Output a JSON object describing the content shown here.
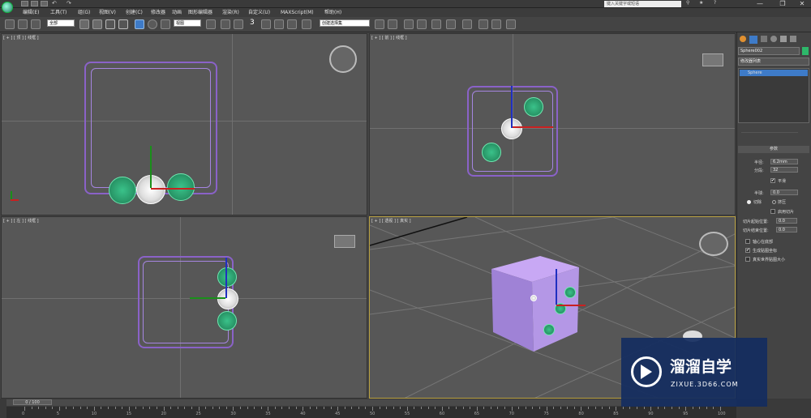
{
  "window": {
    "search_placeholder": "键入关键字或短语",
    "controls": [
      "—",
      "❐",
      "✕"
    ],
    "quick_icons": [
      "▭",
      "▭",
      "▭",
      "↶",
      "↷",
      "▭"
    ]
  },
  "menu": [
    "编辑(E)",
    "工具(T)",
    "组(G)",
    "视图(V)",
    "创建(C)",
    "修改器",
    "动画",
    "图形编辑器",
    "渲染(R)",
    "自定义(U)",
    "MAXScript(M)",
    "帮助(H)"
  ],
  "toolbar": {
    "selection_filter": "全部",
    "ref_coord": "视图",
    "named_selection": "创建选择集",
    "snap_label": "3"
  },
  "viewports": {
    "top": "[ + ] [ 顶 ] [ 线框 ]",
    "front": "[ + ] [ 前 ] [ 线框 ]",
    "left": "[ + ] [ 左 ] [ 线框 ]",
    "persp": "[ + ] [ 透视 ] [ 真实 ]"
  },
  "panel": {
    "object_name": "Sphere002",
    "modifier_list": "修改器列表",
    "stack_item": "Sphere",
    "rollout_title": "参数",
    "radius_label": "半径:",
    "radius_value": "6.2mm",
    "segments_label": "分段:",
    "segments_value": "32",
    "smooth_label": "平滑",
    "hemisphere_label": "半球:",
    "hemisphere_value": "0.0",
    "chop_label": "切除",
    "squash_label": "挤压",
    "slice_on_label": "启用切片",
    "slice_from_label": "切片起始位置:",
    "slice_from_value": "0.0",
    "slice_to_label": "切片结束位置:",
    "slice_to_value": "0.0",
    "base_pivot_label": "轴心在底部",
    "gen_uv_label": "生成贴图坐标",
    "real_world_label": "真实世界贴图大小"
  },
  "timeline": {
    "frame_display": "0 / 100",
    "ticks": [
      "0",
      "5",
      "10",
      "15",
      "20",
      "25",
      "30",
      "35",
      "40",
      "45",
      "50",
      "55",
      "60",
      "65",
      "70",
      "75",
      "80",
      "85",
      "90",
      "95",
      "100"
    ]
  },
  "watermark": {
    "cn": "溜溜自学",
    "url": "ZIXUE.3D66.COM"
  },
  "colors": {
    "purple": "#8a62c8",
    "green_sphere": "#2a9a6a",
    "active_border": "#b8a040"
  }
}
